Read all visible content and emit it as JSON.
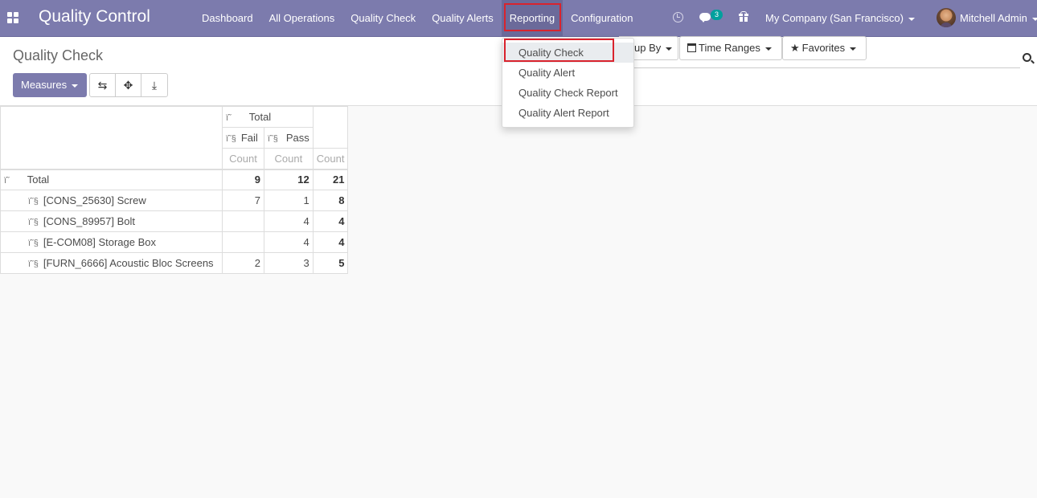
{
  "navbar": {
    "brand": "Quality Control",
    "menu": [
      "Dashboard",
      "All Operations",
      "Quality Check",
      "Quality Alerts",
      "Reporting",
      "Configuration"
    ],
    "active_menu": "Reporting",
    "messages_badge": "3",
    "company": "My Company (San Francisco)",
    "user": "Mitchell Admin",
    "accent_color": "#7c7bad",
    "highlight_color": "#d9232d"
  },
  "control_panel": {
    "breadcrumb": "Quality Check",
    "measures_label": "Measures",
    "groupby_label": "up By",
    "timeranges_label": "Time Ranges",
    "favorites_label": "Favorites"
  },
  "reporting_dropdown": {
    "items": [
      "Quality Check",
      "Quality Alert",
      "Quality Check Report",
      "Quality Alert Report"
    ],
    "focused": "Quality Check"
  },
  "pivot": {
    "col_header_total": "Total",
    "col_glyph": "ï˜",
    "sub_glyph": "ï˜§",
    "columns": [
      "Fail",
      "Pass"
    ],
    "measure": "Count",
    "total_row": {
      "label": "Total",
      "values": [
        "9",
        "12",
        "21"
      ]
    },
    "rows": [
      {
        "label": "[CONS_25630] Screw",
        "values": [
          "7",
          "1",
          "8"
        ]
      },
      {
        "label": "[CONS_89957] Bolt",
        "values": [
          "",
          "4",
          "4"
        ]
      },
      {
        "label": "[E-COM08] Storage Box",
        "values": [
          "",
          "4",
          "4"
        ]
      },
      {
        "label": "[FURN_6666] Acoustic Bloc Screens",
        "values": [
          "2",
          "3",
          "5"
        ]
      }
    ]
  }
}
